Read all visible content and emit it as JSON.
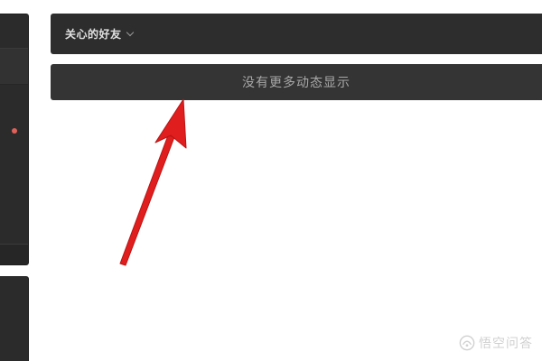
{
  "friends_header": {
    "title": "关心的好友",
    "chevron_icon": "chevron-down-icon"
  },
  "feed": {
    "no_more_text": "没有更多动态显示"
  },
  "sidebar": {
    "notification_dot_color": "#e0605a"
  },
  "annotation": {
    "arrow_color": "#e01e1e"
  },
  "watermark": {
    "text": "悟空问答",
    "icon": "wukong-logo-icon"
  }
}
